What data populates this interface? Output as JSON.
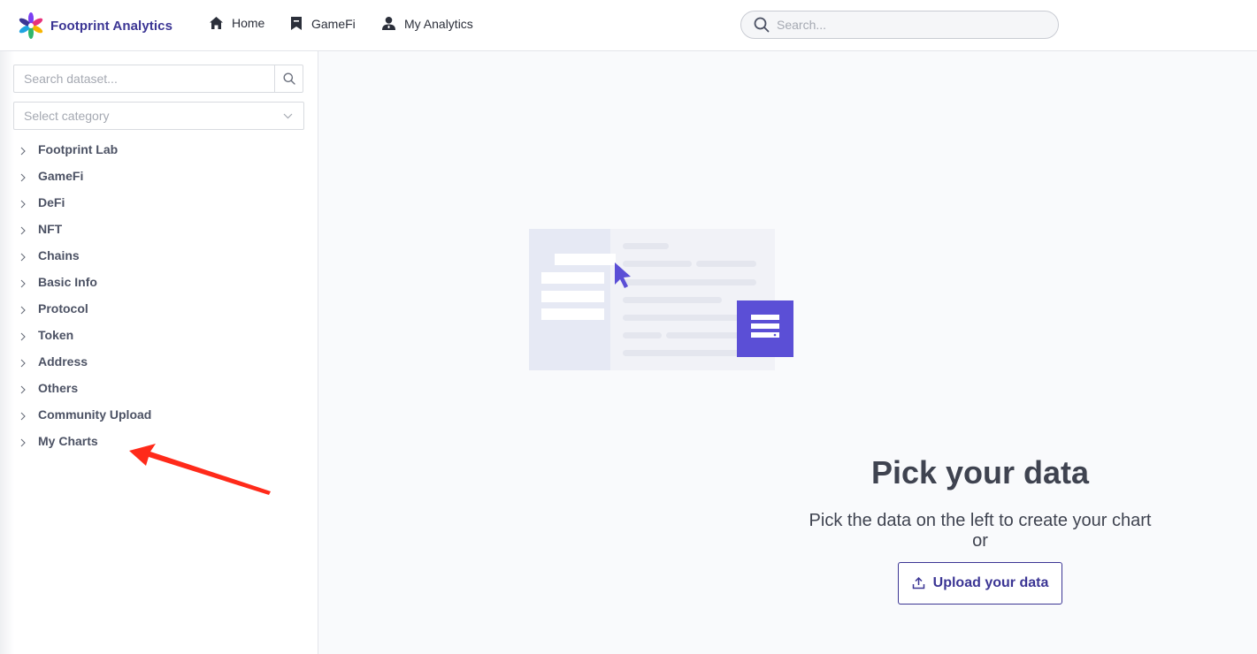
{
  "header": {
    "logo_text": "Footprint Analytics",
    "nav": [
      {
        "label": "Home",
        "icon": "home-icon"
      },
      {
        "label": "GameFi",
        "icon": "bookmark-icon"
      },
      {
        "label": "My Analytics",
        "icon": "user-icon"
      }
    ],
    "search_placeholder": "Search..."
  },
  "sidebar": {
    "search_placeholder": "Search dataset...",
    "category_placeholder": "Select category",
    "items": [
      {
        "label": "Footprint Lab"
      },
      {
        "label": "GameFi"
      },
      {
        "label": "DeFi"
      },
      {
        "label": "NFT"
      },
      {
        "label": "Chains"
      },
      {
        "label": "Basic Info"
      },
      {
        "label": "Protocol"
      },
      {
        "label": "Token"
      },
      {
        "label": "Address"
      },
      {
        "label": "Others"
      },
      {
        "label": "Community Upload"
      },
      {
        "label": "My Charts"
      }
    ]
  },
  "main": {
    "title": "Pick your data",
    "subtitle_line1": "Pick the data on the left to create your chart",
    "subtitle_line2": "or",
    "upload_label": "Upload your data"
  },
  "colors": {
    "brand": "#3b3594",
    "accent": "#5b4fd6",
    "annotation": "#ff2a1a"
  }
}
